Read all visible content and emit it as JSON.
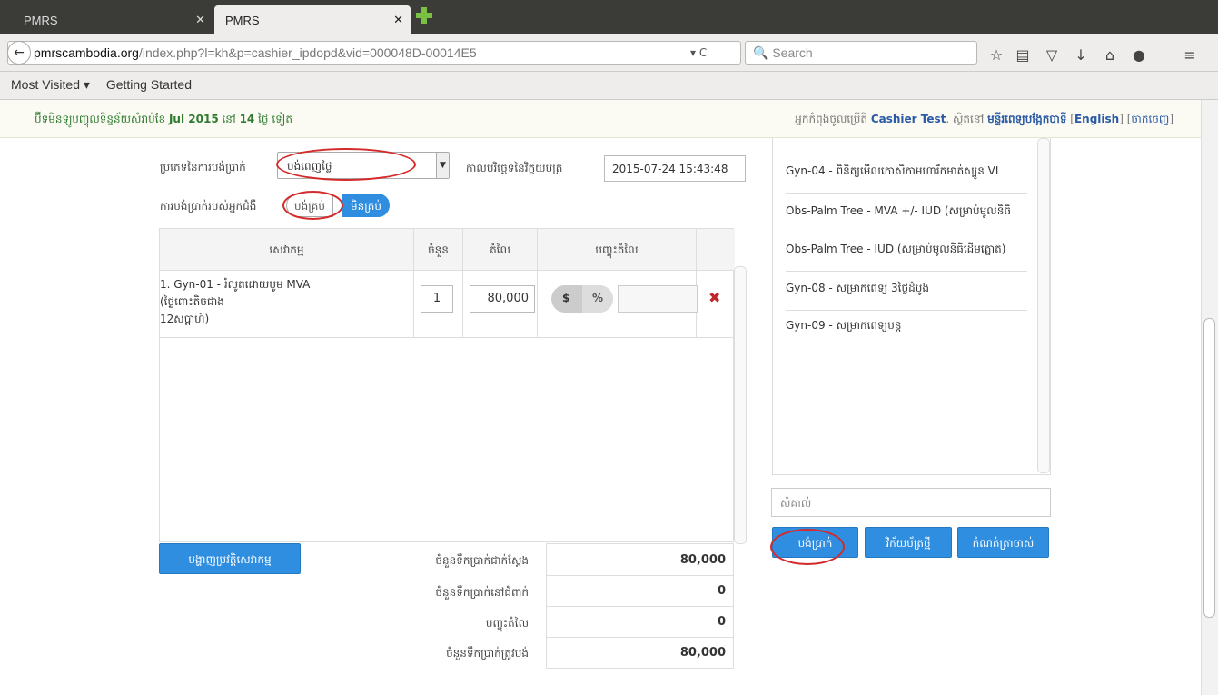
{
  "browser": {
    "tabs": [
      {
        "title": "PMRS"
      },
      {
        "title": "PMRS"
      }
    ],
    "url_host": "pmrscambodia.org",
    "url_path": "/index.php?l=kh&p=cashier_ipdopd&vid=000048D-00014E5",
    "search_placeholder": "Search",
    "bookmarks": [
      "Most Visited ▾",
      "Getting Started"
    ]
  },
  "header": {
    "trial_text_before": "ប៊ីទមិនឡូបញ្ហុលទិន្នន័យសំរាប់ខែ",
    "trial_month": "Jul 2015",
    "trial_mid": "នៅ",
    "trial_days": "14",
    "trial_after": "ថ្ងៃ ទៀត",
    "user_prefix": "អ្នកកំពុងចូលប្រើតី",
    "user_name": "Cashier Test",
    "user_mid": ". ស្ថិតនៅ",
    "location": "មន្ទីរពេទ្យបង្អែកបាទី",
    "lang_link": "English",
    "logout_link": "ចាកចេញ"
  },
  "form": {
    "payment_type_label": "ប្រភេទនៃការបង់ប្រាក់",
    "payment_type_value": "បង់ពេញថ្លៃ",
    "invoice_date_label": "កាលបរិច្ឆេទនៃវិក្កយបត្រ",
    "invoice_date_value": "2015-07-24 15:43:48",
    "patient_payment_label": "ការបង់ប្រាក់របស់អ្នកជំងឺ",
    "toggle_paid": "បង់គ្រប់",
    "toggle_unpaid": "មិនគ្រប់"
  },
  "table": {
    "headers": [
      "សេវាកម្ម",
      "ចំនួន",
      "តំលៃ",
      "បញ្ចុះតំលៃ"
    ],
    "rows": [
      {
        "service_line1": "1. Gyn-01 - រំលូតដោយបូម MVA",
        "service_line2": "(ថ្ងៃពោះតិចជាង",
        "service_line3": "12សប្តាហ៍)",
        "qty": "1",
        "price": "80,000",
        "disc_dollar": "$",
        "disc_pct": "%",
        "delete": "✖"
      }
    ]
  },
  "actions": {
    "show_history": "បង្ហាញប្រវត្តិសេវាកម្ម",
    "pay": "បង់ប្រាក់",
    "new_invoice": "វិក័យប័ត្រថ្មី",
    "old_debt": "កំណត់ត្រាចាស់"
  },
  "totals": [
    {
      "label": "ចំនួនទឹកប្រាក់ជាក់ស្តែង",
      "value": "80,000"
    },
    {
      "label": "ចំនួនទឹកប្រាក់នៅជំពាក់",
      "value": "0"
    },
    {
      "label": "បញ្ចុះតំលៃ",
      "value": "0"
    },
    {
      "label": "ចំនួនទឹកប្រាក់ត្រូវបង់",
      "value": "80,000"
    }
  ],
  "packages": [
    "Gyn-04 - ពិនិត្យមើលកោសិកាមហារីកមាត់ស្បូន VI",
    "Obs-Palm Tree - MVA +/- IUD (សម្រាប់មូលនិធិ",
    "Obs-Palm Tree - IUD (សម្រាប់មូលនិធិដើមត្នោត)",
    "Gyn-08 - សម្រាកពេទ្យ 3ថ្ងៃដំបូង",
    "Gyn-09 - សម្រាកពេទ្យបន្ត"
  ],
  "note_placeholder": "សំគាល់"
}
